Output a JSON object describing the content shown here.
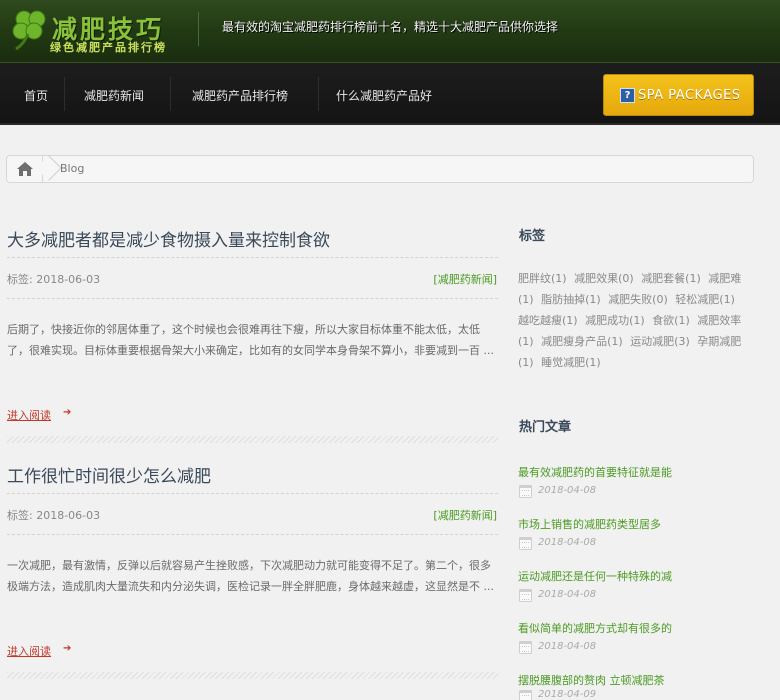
{
  "header": {
    "logo_title": "减肥技巧",
    "logo_subtitle": "绿色减肥产品排行榜",
    "tagline": "最有效的淘宝减肥药排行榜前十名，精选十大减肥产品供你选择"
  },
  "nav": {
    "items": [
      {
        "label": "首页"
      },
      {
        "label": "减肥药新闻"
      },
      {
        "label": "减肥药产品排行榜"
      },
      {
        "label": "什么减肥药产品好"
      }
    ],
    "spa_label": "SPA PACKAGES",
    "spa_icon_glyph": "?"
  },
  "breadcrumb": {
    "current": "Blog"
  },
  "posts": [
    {
      "title": "大多减肥者都是减少食物摄入量来控制食欲",
      "meta": "标签: 2018-06-03",
      "category": "[减肥药新闻]",
      "excerpt": "后期了，快接近你的邻居体重了，这个时候也会很难再往下瘦，所以大家目标体重不能太低，太低了，很难实现。目标体重要根据骨架大小来确定，比如有的女同学本身骨架不算小，非要减到一百 ...",
      "read_more": "进入阅读"
    },
    {
      "title": "工作很忙时间很少怎么减肥",
      "meta": "标签: 2018-06-03",
      "category": "[减肥药新闻]",
      "excerpt": "一次减肥，最有激情，反弹以后就容易产生挫败感，下次减肥动力就可能变得不足了。第二个，很多极端方法，造成肌肉大量流失和内分泌失调，医检记录一胖全胖肥鹿，身体越来越虚，这显然是不 ...",
      "read_more": "进入阅读"
    }
  ],
  "sidebar": {
    "tags_heading": "标签",
    "tags": [
      "肥胖纹(1)",
      "减肥效果(0)",
      "减肥套餐(1)",
      "减肥难(1)",
      "脂肪抽掉(1)",
      "减肥失败(0)",
      "轻松减肥(1)",
      "越吃越瘦(1)",
      "减肥成功(1)",
      "食欲(1)",
      "减肥效率(1)",
      "减肥瘦身产品(1)",
      "运动减肥(3)",
      "孕期减肥(1)",
      "睡觉减肥(1)"
    ],
    "hot_heading": "热门文章",
    "hot_posts": [
      {
        "title": "最有效减肥药的首要特征就是能",
        "date": "2018-04-08"
      },
      {
        "title": "市场上销售的减肥药类型居多",
        "date": "2018-04-08"
      },
      {
        "title": "运动减肥还是任何一种特殊的减",
        "date": "2018-04-08"
      },
      {
        "title": "看似简单的减肥方式却有很多的",
        "date": "2018-04-08"
      },
      {
        "title": "摆脱腰腹部的赘肉 立顿减肥茶",
        "date": "2018-04-09"
      }
    ]
  }
}
